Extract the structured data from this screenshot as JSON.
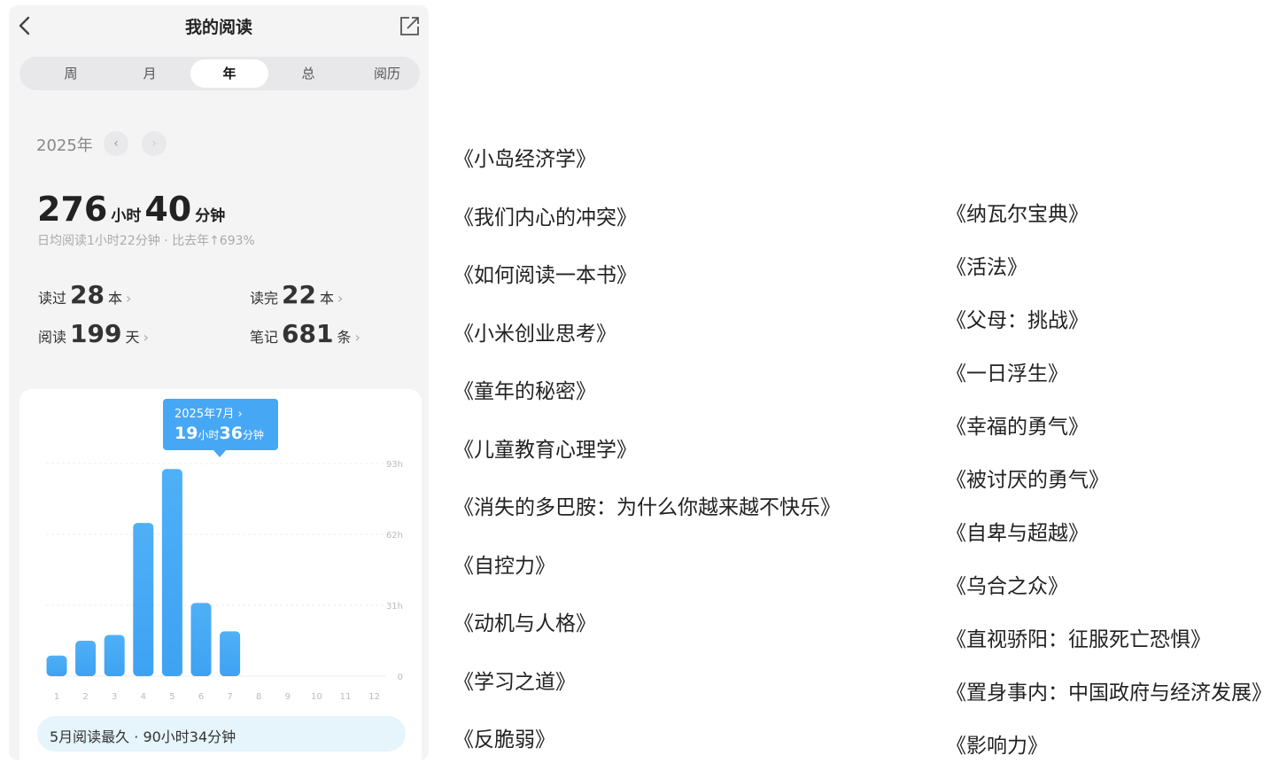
{
  "header": {
    "title": "我的阅读"
  },
  "tabs": [
    {
      "label": "周"
    },
    {
      "label": "月"
    },
    {
      "label": "年",
      "active": true
    },
    {
      "label": "总"
    },
    {
      "label": "阅历"
    }
  ],
  "year": {
    "label": "2025年"
  },
  "summary": {
    "hours": "276",
    "hours_unit": "小时",
    "minutes": "40",
    "minutes_unit": "分钟",
    "sub": "日均阅读1小时22分钟 · 比去年↑693%"
  },
  "stats": {
    "read": {
      "label": "读过",
      "value": "28",
      "unit": "本"
    },
    "finished": {
      "label": "读完",
      "value": "22",
      "unit": "本"
    },
    "days": {
      "label": "阅读",
      "value": "199",
      "unit": "天"
    },
    "notes": {
      "label": "笔记",
      "value": "681",
      "unit": "条"
    }
  },
  "tooltip": {
    "month": "2025年7月",
    "hours": "19",
    "hours_unit": "小时",
    "minutes": "36",
    "minutes_unit": "分钟"
  },
  "chart_data": {
    "type": "bar",
    "categories": [
      "1",
      "2",
      "3",
      "4",
      "5",
      "6",
      "7",
      "8",
      "9",
      "10",
      "11",
      "12"
    ],
    "values": [
      9,
      15.5,
      18,
      67,
      90.6,
      32,
      19.6,
      0,
      0,
      0,
      0,
      0
    ],
    "ylim": [
      0,
      93
    ],
    "yticks": [
      "0",
      "31h",
      "62h",
      "93h"
    ],
    "color": "#3ea2f3"
  },
  "footer_summary": "5月阅读最久 · 90小时34分钟",
  "books_left": [
    "《小岛经济学》",
    "《我们内心的冲突》",
    "《如何阅读一本书》",
    "《小米创业思考》",
    "《童年的秘密》",
    "《儿童教育心理学》",
    "《消失的多巴胺：为什么你越来越不快乐》",
    "《自控力》",
    "《动机与人格》",
    "《学习之道》",
    "《反脆弱》"
  ],
  "books_right": [
    "《纳瓦尔宝典》",
    "《活法》",
    "《父母：挑战》",
    "《一日浮生》",
    "《幸福的勇气》",
    "《被讨厌的勇气》",
    "《自卑与超越》",
    "《乌合之众》",
    "《直视骄阳：征服死亡恐惧》",
    "《置身事内：中国政府与经济发展》",
    "《影响力》"
  ]
}
